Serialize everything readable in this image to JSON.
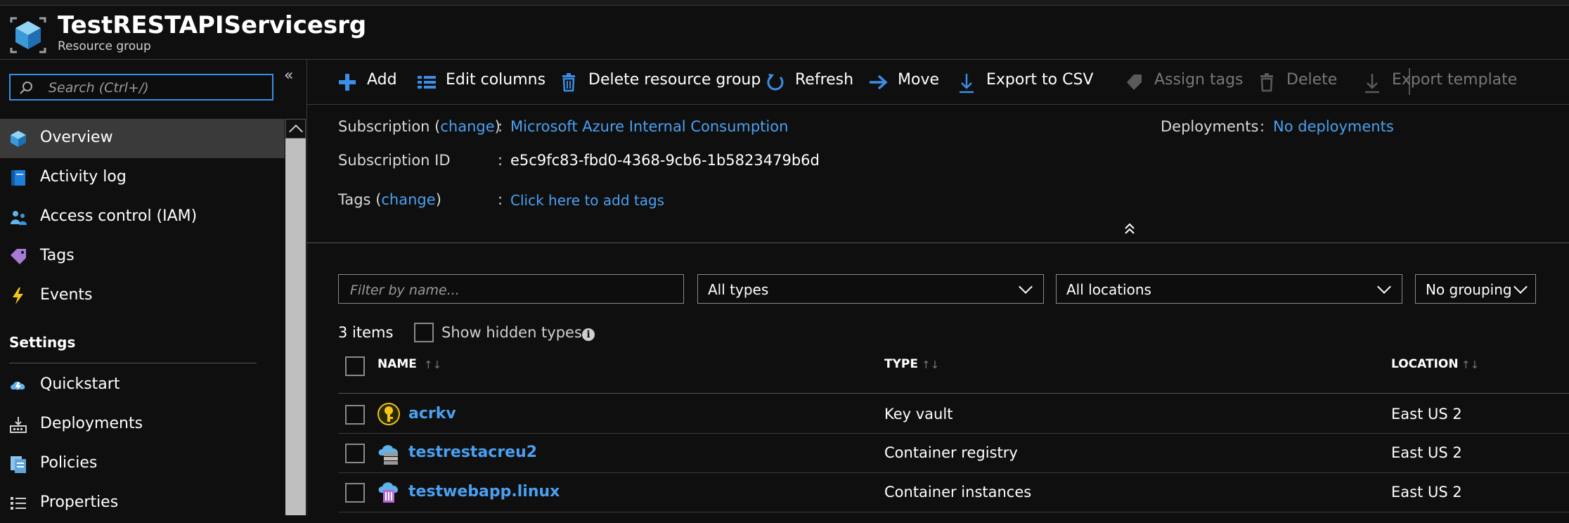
{
  "header": {
    "title": "TestRESTAPIServicesrg",
    "subtitle": "Resource group",
    "icon": "resource-group-cube-icon"
  },
  "sidebar": {
    "search_placeholder": "Search (Ctrl+/)",
    "collapse_glyph": "«",
    "items": [
      {
        "label": "Overview",
        "icon": "overview-cube-icon",
        "active": true
      },
      {
        "label": "Activity log",
        "icon": "activity-log-icon"
      },
      {
        "label": "Access control (IAM)",
        "icon": "access-control-icon"
      },
      {
        "label": "Tags",
        "icon": "tag-icon"
      },
      {
        "label": "Events",
        "icon": "lightning-icon"
      }
    ],
    "settings_title": "Settings",
    "settings_items": [
      {
        "label": "Quickstart",
        "icon": "quickstart-cloud-icon"
      },
      {
        "label": "Deployments",
        "icon": "deployments-icon"
      },
      {
        "label": "Policies",
        "icon": "policies-icon"
      },
      {
        "label": "Properties",
        "icon": "properties-icon"
      }
    ]
  },
  "toolbar": {
    "add": "Add",
    "edit_columns": "Edit columns",
    "delete_rg": "Delete resource group",
    "refresh": "Refresh",
    "move": "Move",
    "export_csv": "Export to CSV",
    "assign_tags": "Assign tags",
    "delete": "Delete",
    "export_template": "Export template"
  },
  "essentials": {
    "subscription_label": "Subscription",
    "change": "change",
    "paren_open": "(",
    "paren_close": ")",
    "colon": ":",
    "subscription_value": "Microsoft Azure Internal Consumption",
    "subscription_id_label": "Subscription ID",
    "subscription_id_value": "e5c9fc83-fbd0-4368-9cb6-1b5823479b6d",
    "tags_label": "Tags",
    "tags_value": "Click here to add tags",
    "deployments_label": "Deployments",
    "deployments_value": "No deployments"
  },
  "filters": {
    "name_placeholder": "Filter by name...",
    "types": "All types",
    "locations": "All locations",
    "grouping": "No grouping"
  },
  "list": {
    "count": "3 items",
    "show_hidden": "Show hidden types",
    "info_glyph": "i",
    "sort_glyph": "↑↓",
    "columns": {
      "name": "NAME",
      "type": "TYPE",
      "location": "LOCATION"
    },
    "rows": [
      {
        "name": "acrkv",
        "type": "Key vault",
        "location": "East US 2",
        "icon": "key-vault-icon"
      },
      {
        "name": "testrestacreu2",
        "type": "Container registry",
        "location": "East US 2",
        "icon": "container-registry-icon"
      },
      {
        "name": "testwebapp.linux",
        "type": "Container instances",
        "location": "East US 2",
        "icon": "container-instances-icon"
      }
    ]
  },
  "colors": {
    "link": "#4aa0f0",
    "accent": "#3b8ee8",
    "active_bg": "#3a3a3a"
  }
}
